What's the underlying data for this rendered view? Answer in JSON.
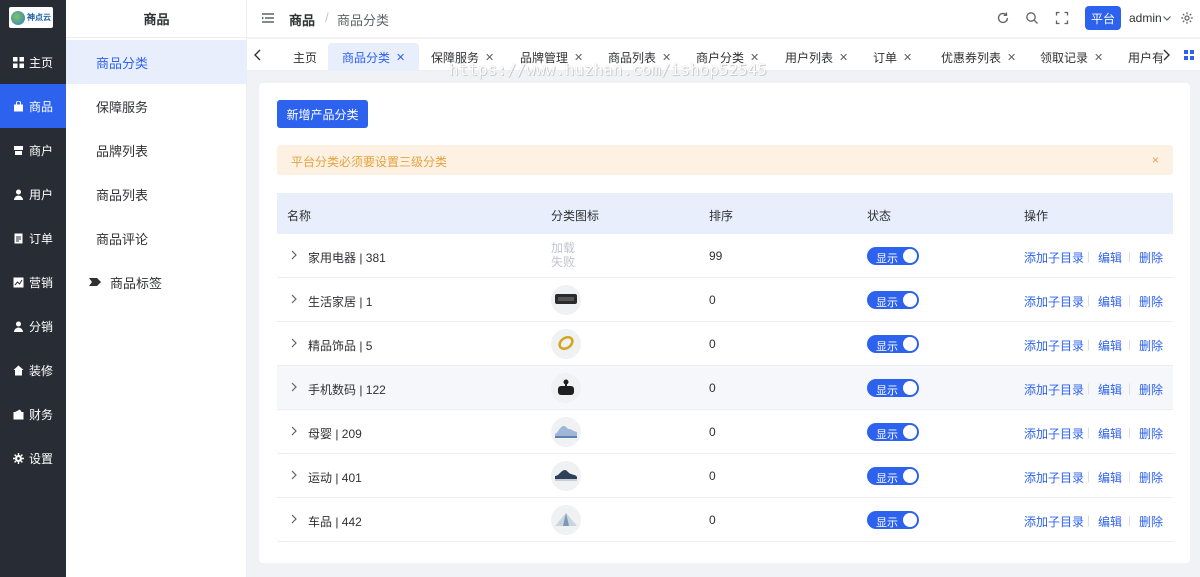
{
  "app": {
    "logo_text": "神点云"
  },
  "rail": {
    "items": [
      {
        "label": "主页",
        "icon": "grid-icon"
      },
      {
        "label": "商品",
        "icon": "bag-icon",
        "active": true
      },
      {
        "label": "商户",
        "icon": "shop-icon"
      },
      {
        "label": "用户",
        "icon": "user-icon"
      },
      {
        "label": "订单",
        "icon": "order-icon"
      },
      {
        "label": "营销",
        "icon": "chart-icon"
      },
      {
        "label": "分销",
        "icon": "distribution-icon"
      },
      {
        "label": "装修",
        "icon": "home-icon"
      },
      {
        "label": "财务",
        "icon": "finance-icon"
      },
      {
        "label": "设置",
        "icon": "gear-icon"
      }
    ]
  },
  "submenu": {
    "title": "商品",
    "items": [
      {
        "label": "商品分类",
        "active": true
      },
      {
        "label": "保障服务"
      },
      {
        "label": "品牌列表"
      },
      {
        "label": "商品列表"
      },
      {
        "label": "商品评论"
      },
      {
        "label": "商品标签",
        "icon": "tag-icon"
      }
    ]
  },
  "header": {
    "breadcrumb": [
      "商品",
      "商品分类"
    ],
    "breadcrumb_sep": "/",
    "platform_button": "平台",
    "user_name": "admin"
  },
  "tabs": [
    {
      "label": "主页",
      "closable": false
    },
    {
      "label": "商品分类",
      "active": true
    },
    {
      "label": "保障服务"
    },
    {
      "label": "品牌管理"
    },
    {
      "label": "商品列表"
    },
    {
      "label": "商户分类"
    },
    {
      "label": "用户列表"
    },
    {
      "label": "订单"
    },
    {
      "label": "优惠券列表"
    },
    {
      "label": "领取记录"
    },
    {
      "label": "用户有"
    }
  ],
  "tab_close_glyph": "✕",
  "watermark": "https://www.huzhan.com/ishop52545",
  "main": {
    "add_button": "新增产品分类",
    "alert_text": "平台分类必须要设置三级分类",
    "alert_close": "×",
    "columns": [
      "名称",
      "分类图标",
      "排序",
      "状态",
      "操作"
    ],
    "icon_fail_text": "加载失败",
    "actions": [
      "添加子目录",
      "编辑",
      "删除"
    ],
    "action_sep": "|",
    "switch_label": "显示",
    "rows": [
      {
        "name": "家用电器 | 381",
        "icon": "load-failed",
        "sort": "99"
      },
      {
        "name": "生活家居 | 1",
        "icon": "device-icon",
        "sort": "0"
      },
      {
        "name": "精品饰品 | 5",
        "icon": "bracelet-icon",
        "sort": "0"
      },
      {
        "name": "手机数码 | 122",
        "icon": "earbuds-icon",
        "sort": "0"
      },
      {
        "name": "母婴 | 209",
        "icon": "baby-shoe-icon",
        "sort": "0"
      },
      {
        "name": "运动 | 401",
        "icon": "sneaker-icon",
        "sort": "0"
      },
      {
        "name": "车品 | 442",
        "icon": "tent-icon",
        "sort": "0"
      }
    ]
  },
  "colors": {
    "primary": "#2d62ee",
    "rail_bg": "#282c34",
    "warning": "#e6a23c"
  }
}
